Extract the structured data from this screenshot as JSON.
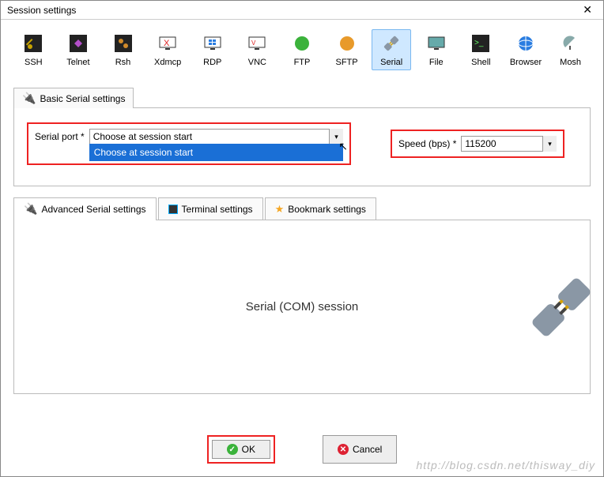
{
  "window": {
    "title": "Session settings"
  },
  "session_types": [
    {
      "id": "ssh",
      "label": "SSH"
    },
    {
      "id": "telnet",
      "label": "Telnet"
    },
    {
      "id": "rsh",
      "label": "Rsh"
    },
    {
      "id": "xdmcp",
      "label": "Xdmcp"
    },
    {
      "id": "rdp",
      "label": "RDP"
    },
    {
      "id": "vnc",
      "label": "VNC"
    },
    {
      "id": "ftp",
      "label": "FTP"
    },
    {
      "id": "sftp",
      "label": "SFTP"
    },
    {
      "id": "serial",
      "label": "Serial",
      "selected": true
    },
    {
      "id": "file",
      "label": "File"
    },
    {
      "id": "shell",
      "label": "Shell"
    },
    {
      "id": "browser",
      "label": "Browser"
    },
    {
      "id": "mosh",
      "label": "Mosh"
    }
  ],
  "basic_tab": {
    "label": "Basic Serial settings"
  },
  "serial_port": {
    "label": "Serial port *",
    "value": "Choose at session start",
    "options": [
      "Choose at session start"
    ]
  },
  "speed": {
    "label": "Speed (bps) *",
    "value": "115200"
  },
  "sub_tabs": [
    {
      "id": "adv",
      "label": "Advanced Serial settings",
      "icon": "serial-icon"
    },
    {
      "id": "term",
      "label": "Terminal settings",
      "icon": "terminal-icon"
    },
    {
      "id": "book",
      "label": "Bookmark settings",
      "icon": "star-icon"
    }
  ],
  "content": {
    "heading": "Serial (COM) session"
  },
  "buttons": {
    "ok": "OK",
    "cancel": "Cancel"
  },
  "watermark": "http://blog.csdn.net/thisway_diy"
}
